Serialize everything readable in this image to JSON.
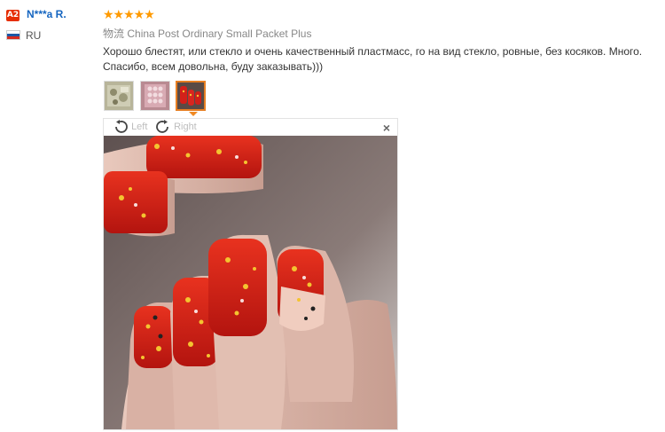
{
  "reviewer": {
    "level_badge": "A2",
    "name": "N***a R.",
    "country": "RU",
    "flag_colors": [
      "#ffffff",
      "#1c57a5",
      "#d52b1e"
    ]
  },
  "review": {
    "rating": 5,
    "stars_text": "★★★★★",
    "shipping_prefix": "物流",
    "shipping_method": "China Post Ordinary Small Packet Plus",
    "text": "Хорошо блестят, или стекло и очень качественный пластмасс, го на вид стекло, ровные, без косяков. Много. Спасибо, всем довольна, буду заказывать)))"
  },
  "thumbnails": [
    {
      "icon": "nail-art-packet-photo"
    },
    {
      "icon": "nail-art-tray-photo"
    },
    {
      "icon": "red-nails-photo",
      "selected": true
    }
  ],
  "viewer": {
    "rotate_left_label": "Left",
    "rotate_right_label": "Right",
    "close_glyph": "×",
    "image": "red-glitter-nails-photo"
  },
  "colors": {
    "accent": "#ff9a00",
    "username": "#1565c0",
    "badge": "#e62e04",
    "selected_border": "#e67e22"
  }
}
